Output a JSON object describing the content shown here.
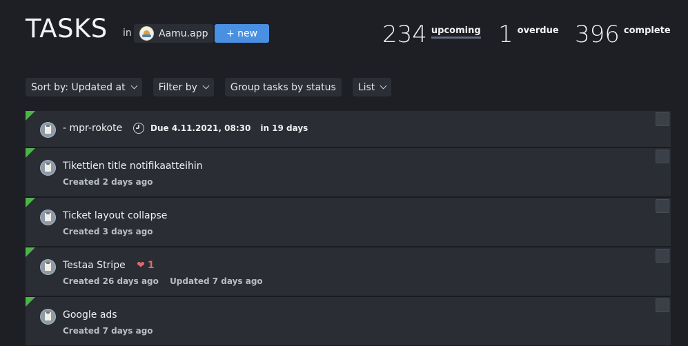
{
  "header": {
    "title": "TASKS",
    "in_label": "in",
    "project_name": "Aamu.app",
    "project_logo_icon": "aamu-logo-icon",
    "new_button_label": "+ new",
    "accent_color": "#4a90e2"
  },
  "stats": {
    "upcoming": {
      "count": "234",
      "label": "upcoming"
    },
    "overdue": {
      "count": "1",
      "label": "overdue"
    },
    "complete": {
      "count": "396",
      "label": "complete"
    }
  },
  "toolbar": {
    "sort_label": "Sort by: Updated at",
    "filter_label": "Filter by",
    "group_label": "Group tasks by status",
    "view_label": "List"
  },
  "tasks": [
    {
      "title": "- mpr-rokote",
      "due": "Due 4.11.2021, 08:30",
      "due_relative": "in 19 days",
      "status_color": "#4cb548"
    },
    {
      "title": "Tikettien title notifikaatteihin",
      "created": "Created 2 days ago",
      "status_color": "#4cb548"
    },
    {
      "title": "Ticket layout collapse",
      "created": "Created 3 days ago",
      "status_color": "#4cb548"
    },
    {
      "title": "Testaa Stripe",
      "likes": "1",
      "created": "Created 26 days ago",
      "updated": "Updated 7 days ago",
      "status_color": "#4cb548"
    },
    {
      "title": "Google ads",
      "created": "Created 7 days ago",
      "status_color": "#4cb548"
    }
  ]
}
